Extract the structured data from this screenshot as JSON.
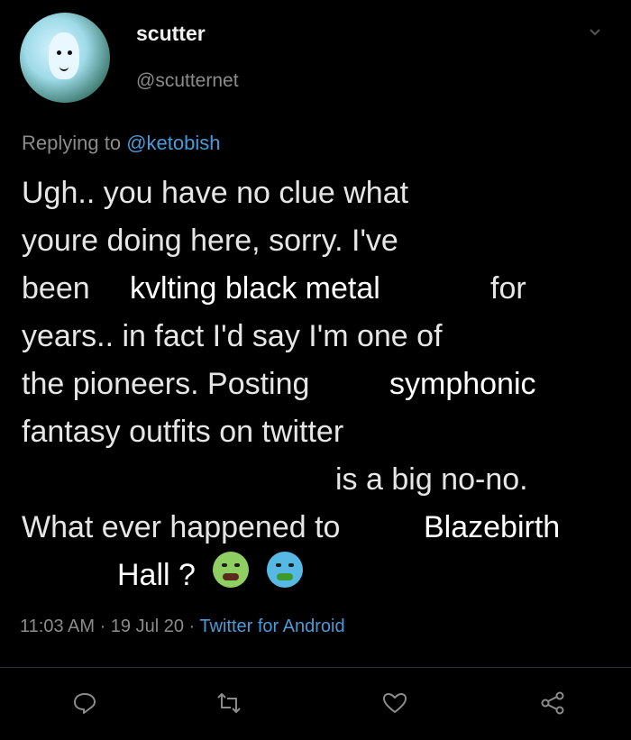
{
  "tweet": {
    "display_name": "scutter",
    "handle": "@scutternet",
    "replying_prefix": "Replying to",
    "replying_to": "@ketobish",
    "lines": [
      "Ugh.. you have no clue what",
      "youre doing here, sorry. I've",
      "been",
      "for",
      "years.. in fact I'd say I'm one of",
      "the pioneers. Posting",
      "fantasy outfits on twitter",
      "is a big no-no.",
      "What ever happened to"
    ],
    "overlays": {
      "kvlting": "kvlting black metal",
      "symphonic": "symphonic",
      "blazebirth": "Blazebirth",
      "hall": "Hall ?"
    },
    "timestamp": "11:03 AM · 19 Jul 20 ·",
    "source": "Twitter for Android"
  },
  "icons": {
    "more": "chevron-down-icon",
    "reply": "reply-icon",
    "retweet": "retweet-icon",
    "like": "heart-icon",
    "share": "share-icon"
  },
  "colors": {
    "background": "#000000",
    "muted": "#8b8b8b",
    "link": "#4a9ad8"
  }
}
